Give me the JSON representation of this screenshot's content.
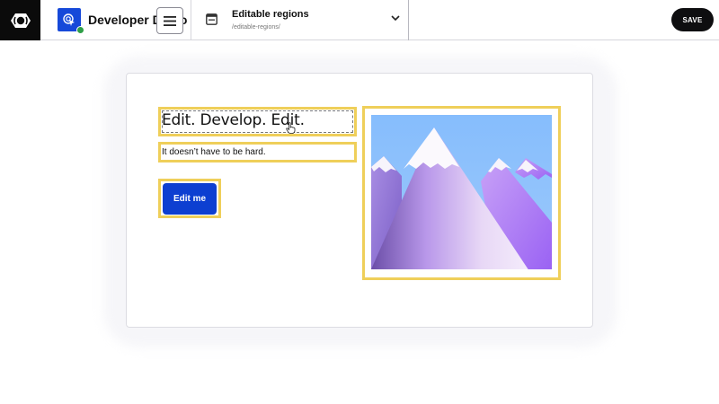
{
  "header": {
    "site_name": "Developer Demo",
    "page_title": "Editable regions",
    "page_path": "/editable-regions/",
    "save_label": "SAVE"
  },
  "content": {
    "heading": "Edit. Develop. Edit.",
    "subheading": "It doesn’t have to be hard.",
    "button_label": "Edit me"
  },
  "icons": {
    "logo": "cloudcannon-logo-icon",
    "site_avatar": "cursor-click-icon",
    "menu": "hamburger-menu-icon",
    "page": "page-layout-icon",
    "dropdown": "chevron-down-icon",
    "status": "check-status-icon",
    "pointer": "hand-pointer-icon"
  },
  "colors": {
    "region_outline": "#efcf5a",
    "button_bg": "#0d3fd1",
    "save_bg": "#0e0e10",
    "avatar_bg": "#1649d9"
  }
}
